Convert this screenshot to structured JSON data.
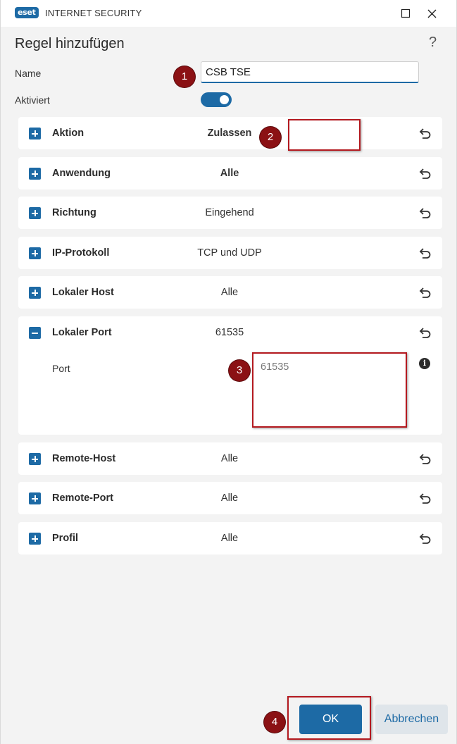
{
  "titlebar": {
    "logo": "eset",
    "product": "INTERNET SECURITY"
  },
  "dialog": {
    "title": "Regel hinzufügen",
    "help": "?"
  },
  "form": {
    "name_label": "Name",
    "name_value": "CSB TSE",
    "activated_label": "Aktiviert",
    "activated": true
  },
  "rules": [
    {
      "title": "Aktion",
      "value": "Zulassen",
      "expanded": false
    },
    {
      "title": "Anwendung",
      "value": "Alle",
      "expanded": false
    },
    {
      "title": "Richtung",
      "value": "Eingehend",
      "expanded": false
    },
    {
      "title": "IP-Protokoll",
      "value": "TCP und UDP",
      "expanded": false
    },
    {
      "title": "Lokaler Host",
      "value": "Alle",
      "expanded": false
    },
    {
      "title": "Lokaler Port",
      "value": "61535",
      "expanded": true,
      "field_label": "Port",
      "field_value": "61535"
    },
    {
      "title": "Remote-Host",
      "value": "Alle",
      "expanded": false
    },
    {
      "title": "Remote-Port",
      "value": "Alle",
      "expanded": false
    },
    {
      "title": "Profil",
      "value": "Alle",
      "expanded": false
    }
  ],
  "annotations": [
    "1",
    "2",
    "3",
    "4"
  ],
  "buttons": {
    "ok": "OK",
    "cancel": "Abbrechen"
  },
  "colors": {
    "accent": "#1d6aa5",
    "annotation": "#8b1114"
  }
}
